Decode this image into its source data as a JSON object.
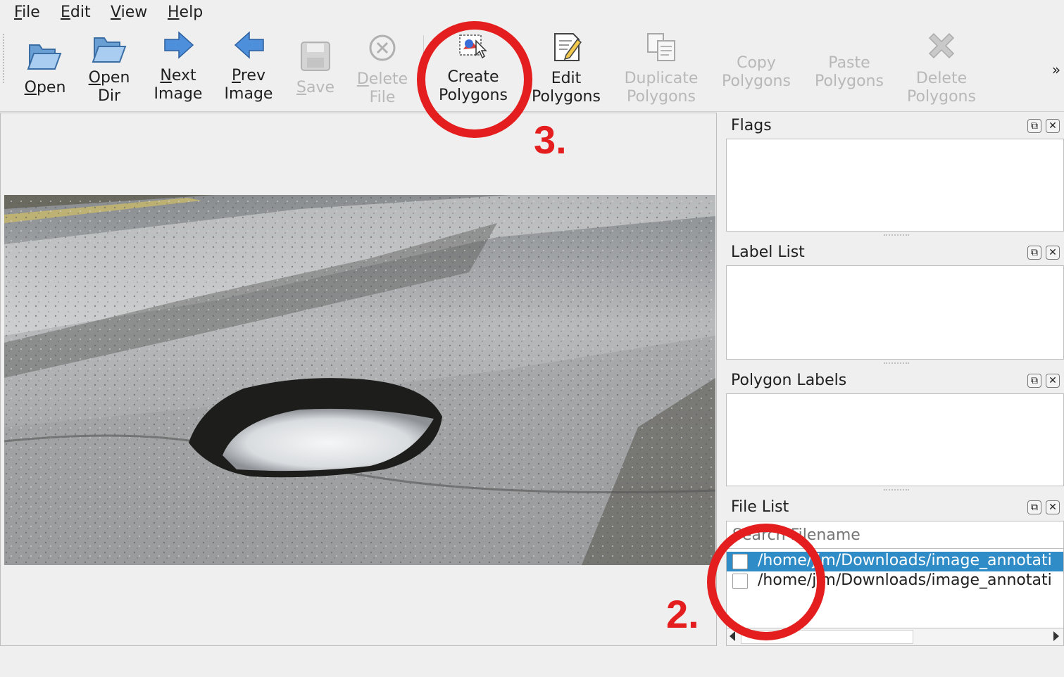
{
  "menu": {
    "file": "File",
    "file_rest": "ile",
    "edit": "Edit",
    "edit_rest": "dit",
    "view": "View",
    "view_rest": "iew",
    "help": "Help",
    "help_rest": "elp"
  },
  "toolbar": {
    "open": {
      "u": "O",
      "rest": "pen",
      "icon": "folder-open-icon"
    },
    "open_dir": {
      "line1_u": "O",
      "line1_rest": "pen",
      "line2": "Dir",
      "icon": "folder-open-icon"
    },
    "next_image": {
      "line1_u": "N",
      "line1_rest": "ext",
      "line2": "Image",
      "icon": "arrow-right-icon"
    },
    "prev_image": {
      "line1_u": "P",
      "line1_rest": "rev",
      "line2": "Image",
      "icon": "arrow-left-icon"
    },
    "save": {
      "u": "S",
      "rest": "ave",
      "icon": "save-icon",
      "enabled": false
    },
    "delete_file": {
      "line1_u": "D",
      "line1_rest": "elete",
      "line2": "File",
      "icon": "delete-circle-icon",
      "enabled": false
    },
    "create_polygons": {
      "line1": "Create",
      "line2": "Polygons",
      "icon": "create-polygon-icon"
    },
    "edit_polygons": {
      "line1": "Edit",
      "line2": "Polygons",
      "icon": "edit-note-icon"
    },
    "duplicate_polygons": {
      "line1": "Duplicate",
      "line2": "Polygons",
      "icon": "duplicate-icon",
      "enabled": false
    },
    "copy_polygons": {
      "line1": "Copy",
      "line2": "Polygons",
      "enabled": false
    },
    "paste_polygons": {
      "line1": "Paste",
      "line2": "Polygons",
      "enabled": false
    },
    "delete_polygons": {
      "line1": "Delete",
      "line2": "Polygons",
      "icon": "delete-x-icon",
      "enabled": false
    },
    "overflow": "»"
  },
  "docks": {
    "flags": {
      "title": "Flags"
    },
    "label_list": {
      "title": "Label List"
    },
    "polygon_labels": {
      "title": "Polygon Labels"
    },
    "file_list": {
      "title": "File List",
      "search_placeholder": "Search Filename",
      "files": [
        {
          "path": "/home/jim/Downloads/image_annotati",
          "checked": false,
          "selected": true
        },
        {
          "path": "/home/jim/Downloads/image_annotati",
          "checked": false,
          "selected": false
        }
      ]
    }
  },
  "annotations": {
    "step2": "2.",
    "step3": "3.",
    "color": "#e41e1e"
  },
  "canvas": {
    "image": "pothole-road-photo"
  }
}
